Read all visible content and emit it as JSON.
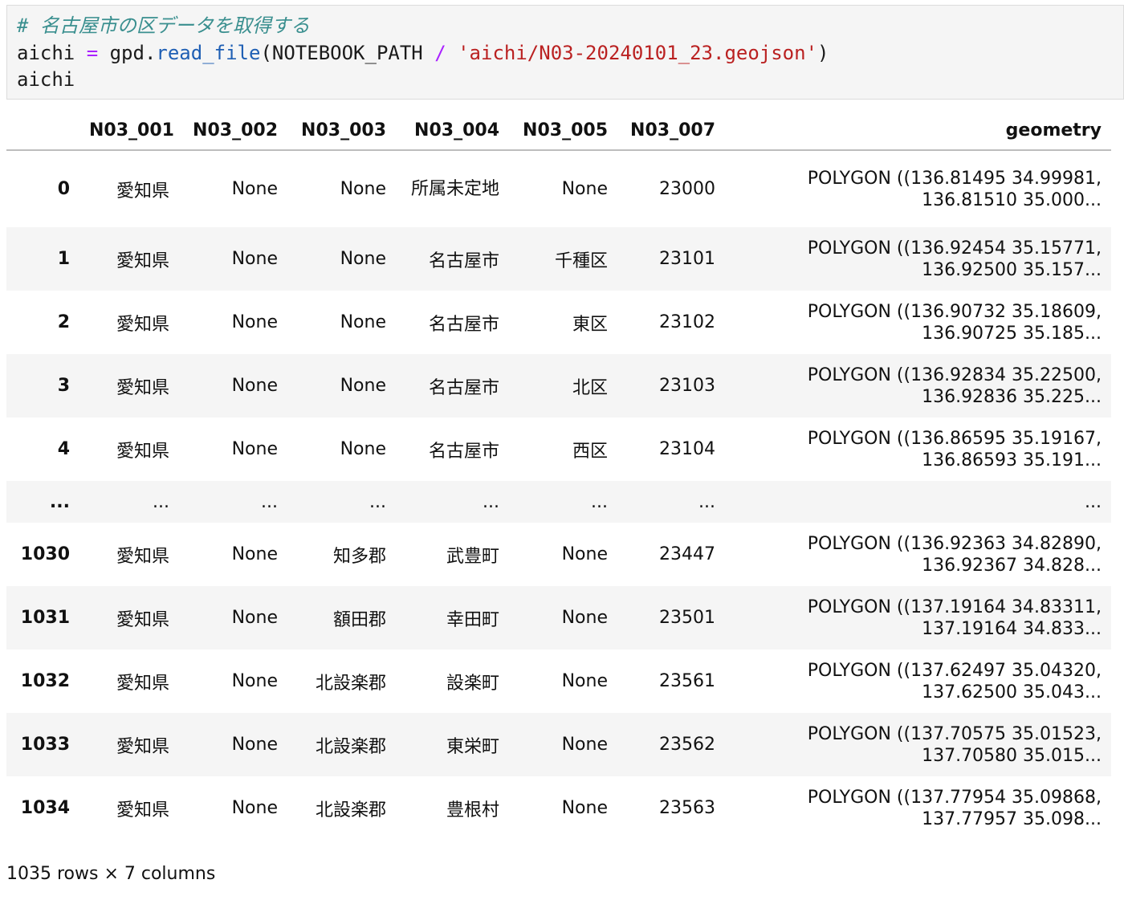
{
  "code": {
    "comment": "# 名古屋市の区データを取得する",
    "line2": {
      "var": "aichi",
      "eq": "=",
      "obj": "gpd.",
      "func": "read_file",
      "open": "(NOTEBOOK_PATH ",
      "slash": "/",
      "string": " 'aichi/N03-20240101_23.geojson'",
      "close": ")"
    },
    "line3": "aichi"
  },
  "table": {
    "columns": [
      "",
      "N03_001",
      "N03_002",
      "N03_003",
      "N03_004",
      "N03_005",
      "N03_007",
      "geometry"
    ],
    "rows": [
      {
        "index": "0",
        "cells": [
          "愛知県",
          "None",
          "None",
          "所属未定地",
          "None",
          "23000"
        ],
        "geom1": "POLYGON ((136.81495 34.99981,",
        "geom2": "136.81510 35.000..."
      },
      {
        "index": "1",
        "cells": [
          "愛知県",
          "None",
          "None",
          "名古屋市",
          "千種区",
          "23101"
        ],
        "geom1": "POLYGON ((136.92454 35.15771,",
        "geom2": "136.92500 35.157..."
      },
      {
        "index": "2",
        "cells": [
          "愛知県",
          "None",
          "None",
          "名古屋市",
          "東区",
          "23102"
        ],
        "geom1": "POLYGON ((136.90732 35.18609,",
        "geom2": "136.90725 35.185..."
      },
      {
        "index": "3",
        "cells": [
          "愛知県",
          "None",
          "None",
          "名古屋市",
          "北区",
          "23103"
        ],
        "geom1": "POLYGON ((136.92834 35.22500,",
        "geom2": "136.92836 35.225..."
      },
      {
        "index": "4",
        "cells": [
          "愛知県",
          "None",
          "None",
          "名古屋市",
          "西区",
          "23104"
        ],
        "geom1": "POLYGON ((136.86595 35.19167,",
        "geom2": "136.86593 35.191..."
      },
      {
        "index": "...",
        "cells": [
          "...",
          "...",
          "...",
          "...",
          "...",
          "..."
        ],
        "geom1": "...",
        "geom2": ""
      },
      {
        "index": "1030",
        "cells": [
          "愛知県",
          "None",
          "知多郡",
          "武豊町",
          "None",
          "23447"
        ],
        "geom1": "POLYGON ((136.92363 34.82890,",
        "geom2": "136.92367 34.828..."
      },
      {
        "index": "1031",
        "cells": [
          "愛知県",
          "None",
          "額田郡",
          "幸田町",
          "None",
          "23501"
        ],
        "geom1": "POLYGON ((137.19164 34.83311,",
        "geom2": "137.19164 34.833..."
      },
      {
        "index": "1032",
        "cells": [
          "愛知県",
          "None",
          "北設楽郡",
          "設楽町",
          "None",
          "23561"
        ],
        "geom1": "POLYGON ((137.62497 35.04320,",
        "geom2": "137.62500 35.043..."
      },
      {
        "index": "1033",
        "cells": [
          "愛知県",
          "None",
          "北設楽郡",
          "東栄町",
          "None",
          "23562"
        ],
        "geom1": "POLYGON ((137.70575 35.01523,",
        "geom2": "137.70580 35.015..."
      },
      {
        "index": "1034",
        "cells": [
          "愛知県",
          "None",
          "北設楽郡",
          "豊根村",
          "None",
          "23563"
        ],
        "geom1": "POLYGON ((137.77954 35.09868,",
        "geom2": "137.77957 35.098..."
      }
    ]
  },
  "footer": "1035 rows × 7 columns"
}
